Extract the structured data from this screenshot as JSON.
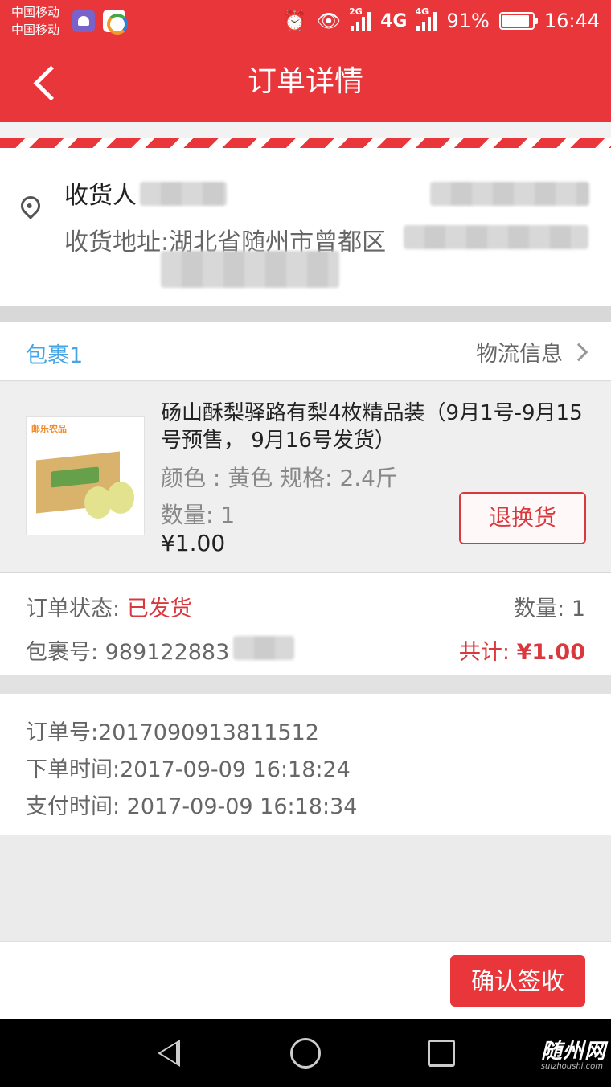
{
  "status_bar": {
    "carrier_1": "中国移动",
    "carrier_2": "中国移动",
    "net_badge": "2G",
    "fourg": "4G",
    "net_badge_2": "4G",
    "battery": "91%",
    "battery_level": 0.91,
    "time": "16:44"
  },
  "header": {
    "title": "订单详情"
  },
  "address": {
    "receiver_label": "收货人",
    "address_label": "收货地址:湖北省随州市曾都区"
  },
  "package": {
    "name": "包裹1",
    "logistics_label": "物流信息",
    "product": {
      "thumb_brand": "邮乐农品",
      "title": "砀山酥梨驿路有梨4枚精品装（9月1号-9月15号预售， 9月16号发货）",
      "spec": "颜色 : 黄色  规格: 2.4斤",
      "qty": "数量:    1",
      "price": "¥1.00",
      "return_button": "退换货"
    }
  },
  "summary": {
    "status_label": "订单状态: ",
    "status_value": "已发货",
    "quantity": "数量: 1",
    "package_no": "包裹号: 989122883",
    "total_label": "共计: ",
    "total_value": "¥1.00"
  },
  "order_info": {
    "order_no": "订单号:2017090913811512",
    "order_time": "下单时间:2017-09-09 16:18:24",
    "pay_time": "支付时间: 2017-09-09 16:18:34"
  },
  "actions": {
    "confirm_button": "确认签收"
  },
  "watermark": {
    "main": "随州网",
    "sub": "suizhoushi.com"
  },
  "colors": {
    "brand_red": "#e8363b",
    "link_blue": "#45a4e6",
    "text_gray": "#666666"
  }
}
